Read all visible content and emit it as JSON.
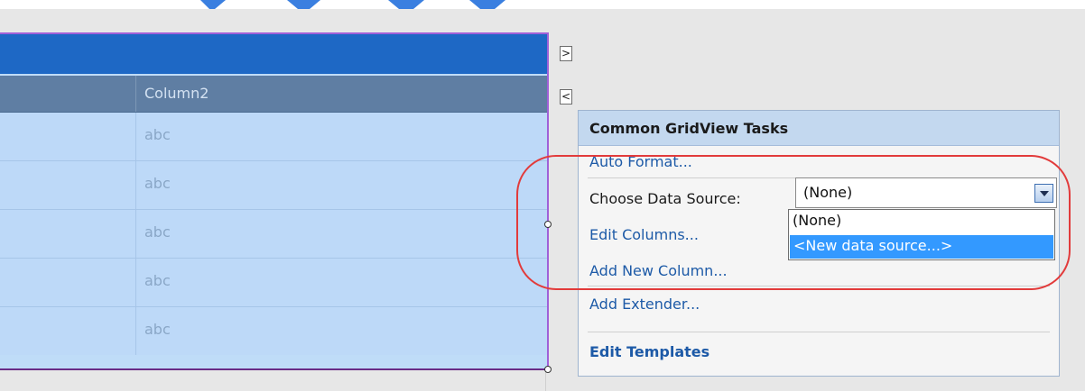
{
  "grid": {
    "header_column2": "Column2",
    "rows": [
      "abc",
      "abc",
      "abc",
      "abc",
      "abc"
    ]
  },
  "smart_tag": {
    "expand_glyph": ">",
    "collapse_glyph": "<"
  },
  "tasks_panel": {
    "title": "Common GridView Tasks",
    "auto_format": "Auto Format...",
    "choose_data_source_label": "Choose Data Source:",
    "data_source_value": "(None)",
    "data_source_options": [
      "(None)",
      "<New data source...>"
    ],
    "edit_columns": "Edit Columns...",
    "add_new_column": "Add New Column...",
    "add_extender": "Add Extender...",
    "edit_templates": "Edit Templates"
  },
  "colors": {
    "grid_header_bar": "#1e68c5",
    "grid_header_row": "#5f7ea3",
    "grid_row": "#bdd9f8",
    "link": "#1d5aa7",
    "selection": "#3399ff",
    "annotation": "#e23b3b"
  }
}
